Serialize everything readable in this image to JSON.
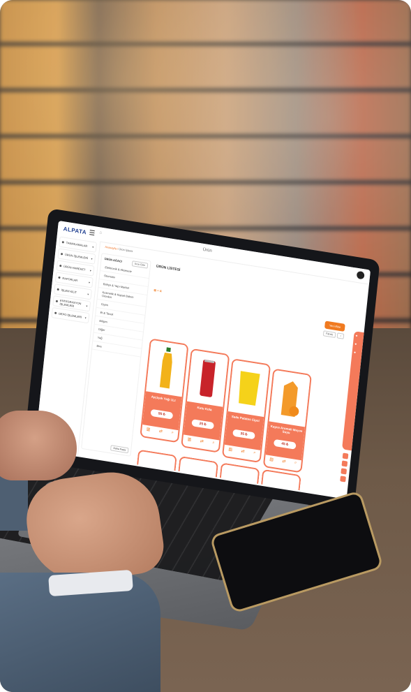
{
  "app": {
    "logo": "ALPATA",
    "page_title": "Ürün",
    "breadcrumb_home": "Anasayfa",
    "breadcrumb_current": "Ürün İşlemi"
  },
  "sidebar": {
    "items": [
      {
        "label": "TANIMLAMALAR"
      },
      {
        "label": "ÜRÜN İŞLEMLERİ"
      },
      {
        "label": "ÜRÜN HAREKET"
      },
      {
        "label": "RAPORLAR"
      },
      {
        "label": "İŞLEM KİLİT"
      },
      {
        "label": "ENTEGRASYON İŞLEMLERİ"
      },
      {
        "label": "DEPO İŞLEMLERİ"
      }
    ]
  },
  "tree": {
    "title": "ÜRÜN AĞACI",
    "button": "Ürün Ekle",
    "items": [
      {
        "label": "Elektronik & Aksesuar"
      },
      {
        "label": "Otomotiv"
      },
      {
        "label": "Bahçe & Yapı Market"
      },
      {
        "label": "Kozmetik & Kişisel Bakım Ürünleri"
      },
      {
        "label": "Giyim"
      },
      {
        "label": "Et & Tavuk"
      },
      {
        "label": "Bilişim"
      },
      {
        "label": "Diğer"
      },
      {
        "label": "Yağ"
      },
      {
        "label": "Bira"
      }
    ],
    "more_button": "Daha Fazla"
  },
  "product_list": {
    "title": "ÜRÜN LİSTESİ",
    "add_button": "Yeni Ekle",
    "filter_button": "Filtrele",
    "products": [
      {
        "name": "Ayçiçek Yağı 1Lt",
        "price": "95 ₺"
      },
      {
        "name": "Kutu Kola",
        "price": "25 ₺"
      },
      {
        "name": "Sade Patates Cipsi",
        "price": "35 ₺"
      },
      {
        "name": "Kayısı Aromalı Meyve Suyu",
        "price": "45 ₺"
      }
    ]
  },
  "colors": {
    "accent": "#f47a5a",
    "brand": "#1d3d8f"
  }
}
